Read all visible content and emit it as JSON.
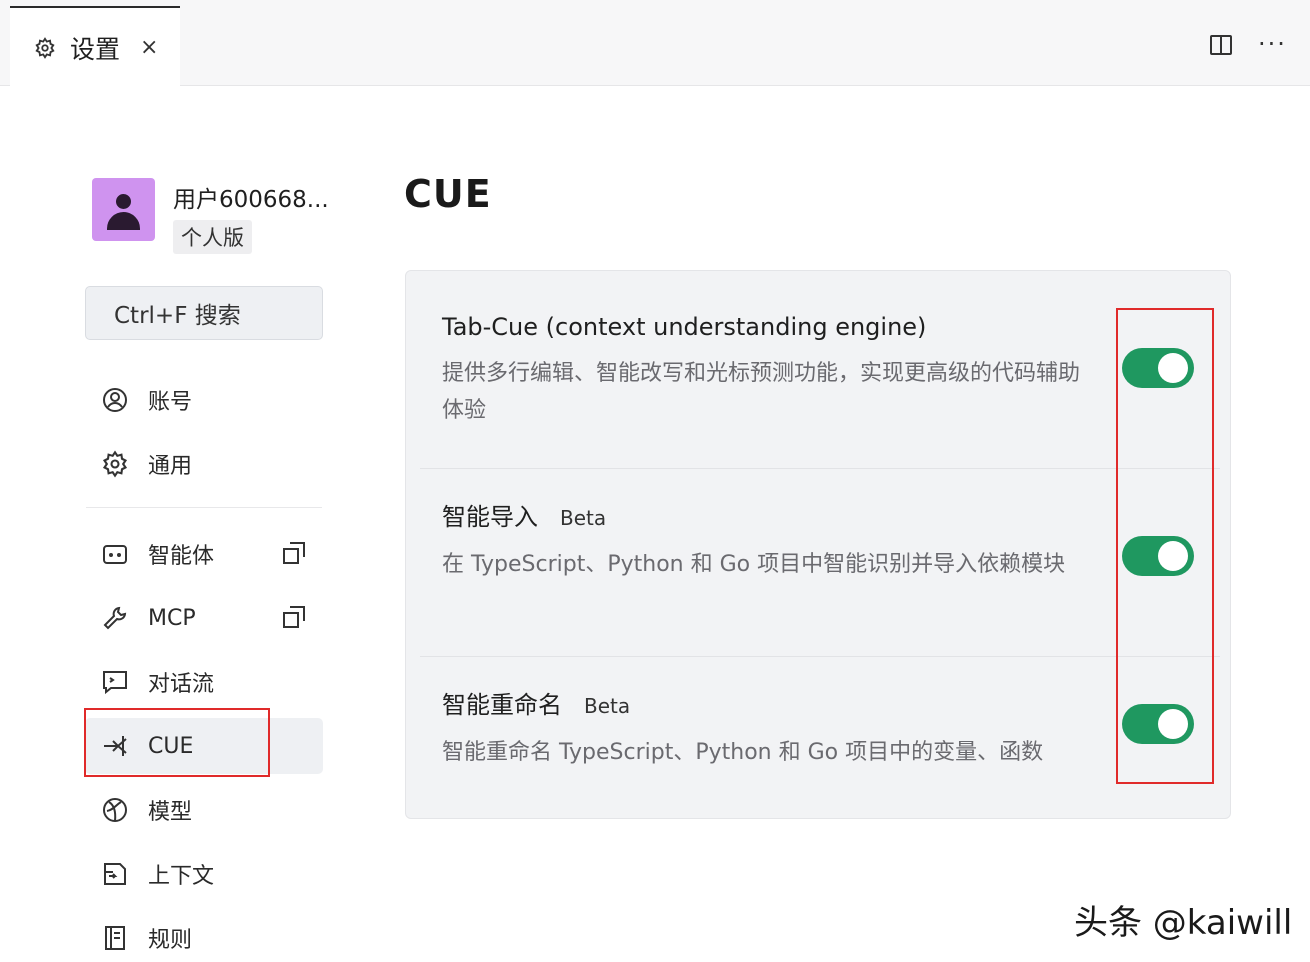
{
  "tab": {
    "title": "设置",
    "close": "×"
  },
  "header": {
    "more": "···"
  },
  "profile": {
    "name": "用户600668...",
    "plan": "个人版"
  },
  "search": {
    "label": "Ctrl+F 搜索"
  },
  "nav": {
    "account": "账号",
    "general": "通用",
    "agents": "智能体",
    "mcp": "MCP",
    "flow": "对话流",
    "cue": "CUE",
    "models": "模型",
    "context": "上下文",
    "rules": "规则"
  },
  "page": {
    "title": "CUE"
  },
  "settings": [
    {
      "title": "Tab-Cue (context understanding engine)",
      "beta": "",
      "desc": "提供多行编辑、智能改写和光标预测功能，实现更高级的代码辅助体验",
      "enabled": true
    },
    {
      "title": "智能导入",
      "beta": "Beta",
      "desc": "在 TypeScript、Python 和 Go 项目中智能识别并导入依赖模块",
      "enabled": true
    },
    {
      "title": "智能重命名",
      "beta": "Beta",
      "desc": "智能重命名 TypeScript、Python 和 Go 项目中的变量、函数",
      "enabled": true
    }
  ],
  "watermark": "头条 @kaiwill",
  "colors": {
    "toggle_on": "#1f9860",
    "highlight": "#e02a2a",
    "avatar": "#cf93ef"
  }
}
